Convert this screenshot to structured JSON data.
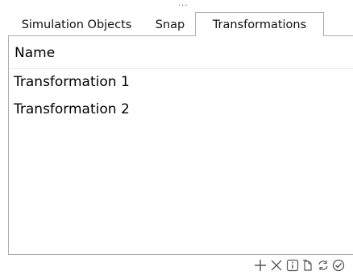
{
  "panel_grip": "...",
  "tabs": [
    {
      "label": "Simulation Objects"
    },
    {
      "label": "Snap"
    },
    {
      "label": "Transformations",
      "active": true
    }
  ],
  "list": {
    "header": "Name",
    "rows": [
      "Transformation 1",
      "Transformation 2"
    ]
  },
  "toolbar": {
    "icons": [
      "add-icon",
      "delete-icon",
      "info-icon",
      "copy-icon",
      "refresh-icon",
      "check-icon"
    ]
  },
  "colors": {
    "border": "#adadad",
    "icon": "#555555",
    "background": "#ffffff"
  }
}
